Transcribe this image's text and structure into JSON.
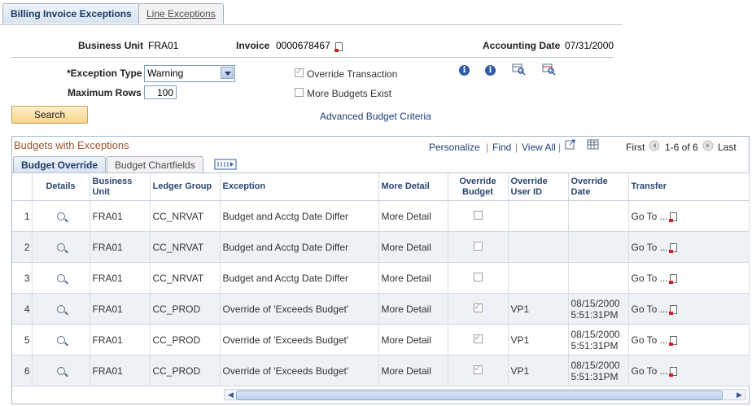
{
  "tabs": [
    {
      "label": "Billing Invoice Exceptions",
      "active": true
    },
    {
      "label": "Line Exceptions",
      "active": false
    }
  ],
  "header": {
    "business_unit_label": "Business Unit",
    "business_unit_value": "FRA01",
    "invoice_label": "Invoice",
    "invoice_value": "0000678467",
    "accounting_date_label": "Accounting Date",
    "accounting_date_value": "07/31/2000"
  },
  "filters": {
    "exception_type_label": "*Exception Type",
    "exception_type_value": "Warning",
    "max_rows_label": "Maximum Rows",
    "max_rows_value": "100",
    "override_transaction_label": "Override Transaction",
    "override_transaction_checked": true,
    "more_budgets_label": "More Budgets Exist",
    "more_budgets_checked": false,
    "search_label": "Search",
    "advanced_link": "Advanced Budget Criteria"
  },
  "grid": {
    "title": "Budgets with Exceptions",
    "personalize": "Personalize",
    "find": "Find",
    "view_all": "View All",
    "first": "First",
    "range": "1-6 of 6",
    "last": "Last",
    "subtabs": [
      {
        "label": "Budget Override",
        "active": true
      },
      {
        "label": "Budget Chartfields",
        "active": false
      }
    ],
    "columns": [
      "Details",
      "Business Unit",
      "Ledger Group",
      "Exception",
      "More Detail",
      "Override Budget",
      "Override User ID",
      "Override Date",
      "Transfer"
    ],
    "rows": [
      {
        "num": "1",
        "bu": "FRA01",
        "ledger": "CC_NRVAT",
        "exception": "Budget and Acctg Date Differ",
        "more": "More Detail",
        "override": false,
        "user": "",
        "date1": "",
        "date2": "",
        "transfer": "Go To ..."
      },
      {
        "num": "2",
        "bu": "FRA01",
        "ledger": "CC_NRVAT",
        "exception": "Budget and Acctg Date Differ",
        "more": "More Detail",
        "override": false,
        "user": "",
        "date1": "",
        "date2": "",
        "transfer": "Go To ..."
      },
      {
        "num": "3",
        "bu": "FRA01",
        "ledger": "CC_NRVAT",
        "exception": "Budget and Acctg Date Differ",
        "more": "More Detail",
        "override": false,
        "user": "",
        "date1": "",
        "date2": "",
        "transfer": "Go To ..."
      },
      {
        "num": "4",
        "bu": "FRA01",
        "ledger": "CC_PROD",
        "exception": "Override of 'Exceeds Budget'",
        "more": "More Detail",
        "override": true,
        "user": "VP1",
        "date1": "08/15/2000",
        "date2": "5:51:31PM",
        "transfer": "Go To ..."
      },
      {
        "num": "5",
        "bu": "FRA01",
        "ledger": "CC_PROD",
        "exception": "Override of 'Exceeds Budget'",
        "more": "More Detail",
        "override": true,
        "user": "VP1",
        "date1": "08/15/2000",
        "date2": "5:51:31PM",
        "transfer": "Go To ..."
      },
      {
        "num": "6",
        "bu": "FRA01",
        "ledger": "CC_PROD",
        "exception": "Override of 'Exceeds Budget'",
        "more": "More Detail",
        "override": true,
        "user": "VP1",
        "date1": "08/15/2000",
        "date2": "5:51:31PM",
        "transfer": "Go To ..."
      }
    ]
  }
}
